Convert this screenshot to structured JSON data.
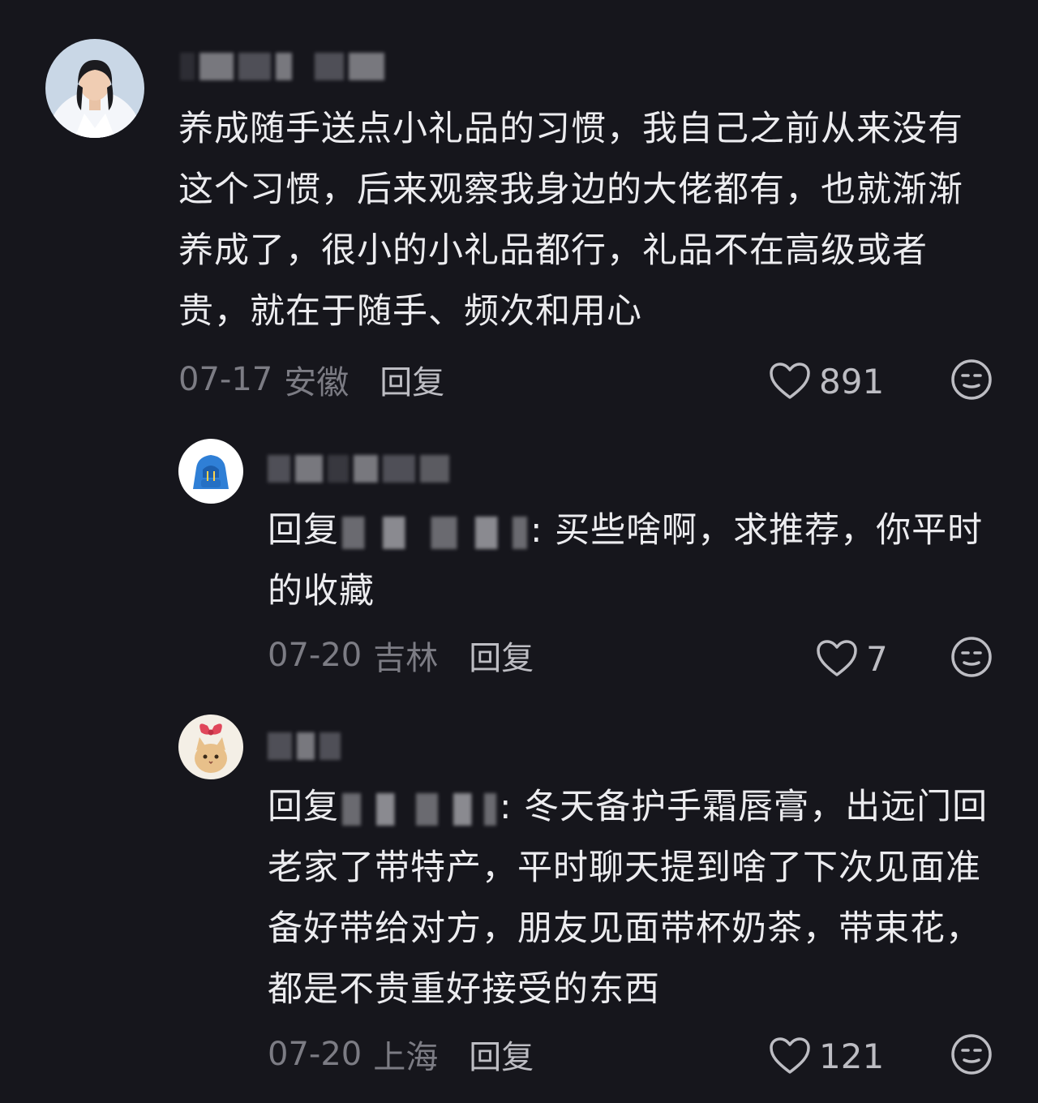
{
  "comments": [
    {
      "text": "养成随手送点小礼品的习惯，我自己之前从来没有这个习惯，后来观察我身边的大佬都有，也就渐渐养成了，很小的小礼品都行，礼品不在高级或者贵，就在于随手、频次和用心",
      "date": "07-17",
      "location": "安徽",
      "reply_label": "回复",
      "likes": "891",
      "avatar_icon": "woman-portrait-avatar"
    },
    {
      "reply_prefix": "回复",
      "text": ": 买些啥啊，求推荐，你平时的收藏",
      "date": "07-20",
      "location": "吉林",
      "reply_label": "回复",
      "likes": "7",
      "avatar_icon": "blue-hoodie-avatar"
    },
    {
      "reply_prefix": "回复",
      "text": ": 冬天备护手霜唇膏，出远门回老家了带特产，平时聊天提到啥了下次见面准备好带给对方，朋友见面带杯奶茶，带束花，都是不贵重好接受的东西",
      "date": "07-20",
      "location": "上海",
      "reply_label": "回复",
      "likes": "121",
      "avatar_icon": "cat-bow-avatar"
    }
  ],
  "colors": {
    "background": "#16161c",
    "text": "#ececef",
    "meta": "#7c7c84",
    "action": "#bdbdc3"
  }
}
